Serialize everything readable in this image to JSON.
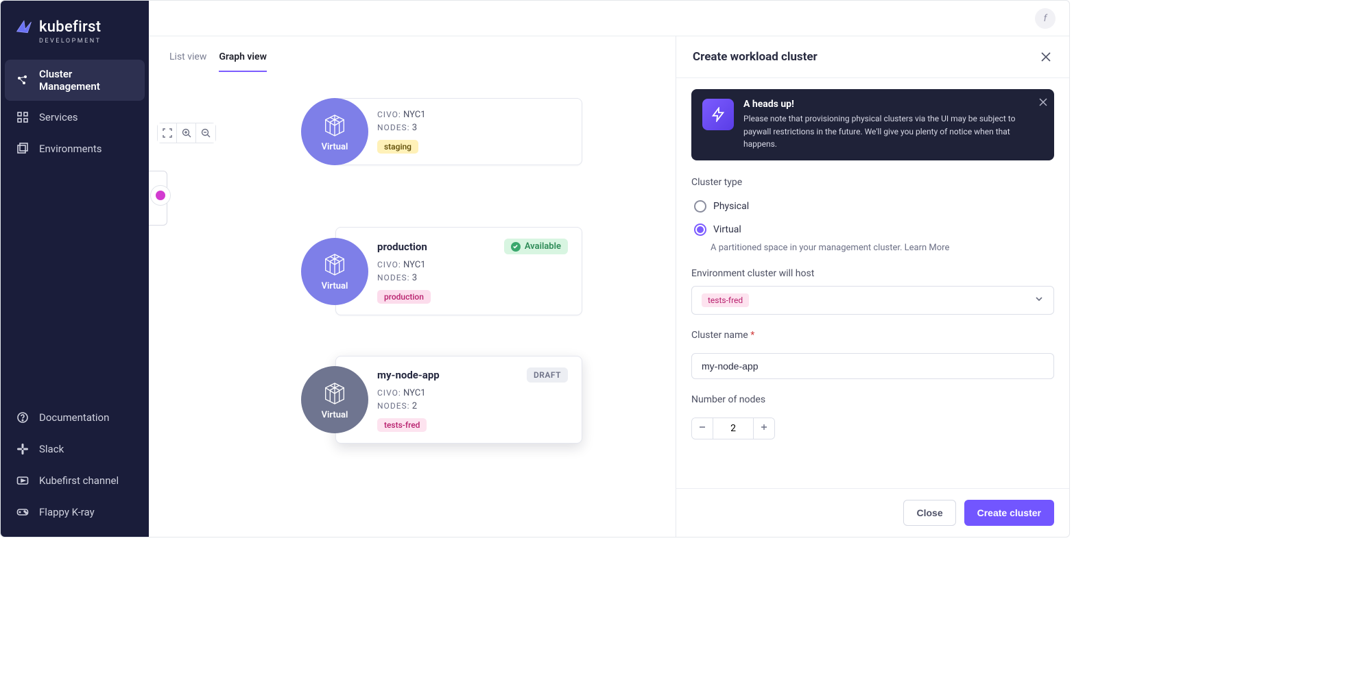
{
  "brand": {
    "name": "kubefirst",
    "sub": "DEVELOPMENT"
  },
  "avatar": {
    "initials": "f"
  },
  "nav": {
    "top": [
      {
        "label": "Cluster Management",
        "icon": "cluster-icon",
        "active": true
      },
      {
        "label": "Services",
        "icon": "grid-icon",
        "active": false
      },
      {
        "label": "Environments",
        "icon": "stack-icon",
        "active": false
      }
    ],
    "bottom": [
      {
        "label": "Documentation",
        "icon": "help-circle-icon"
      },
      {
        "label": "Slack",
        "icon": "slack-icon"
      },
      {
        "label": "Kubefirst channel",
        "icon": "youtube-icon"
      },
      {
        "label": "Flappy K-ray",
        "icon": "gamepad-icon"
      }
    ]
  },
  "tabs": {
    "list": "List view",
    "graph": "Graph view",
    "active": "graph"
  },
  "graph": {
    "tools": [
      "fit-icon",
      "zoom-in-icon",
      "zoom-out-icon"
    ],
    "hub": {
      "color": "#d23bd0"
    },
    "nodes": [
      {
        "kind": "virtual",
        "kind_label": "Virtual",
        "title_hidden": true,
        "cloud_label": "CIVO:",
        "cloud_value": "NYC1",
        "nodes_label": "NODES:",
        "nodes_value": "3",
        "env_tag": "staging",
        "env_class": "staging"
      },
      {
        "kind": "virtual",
        "kind_label": "Virtual",
        "title": "production",
        "status": {
          "label": "Available",
          "kind": "available"
        },
        "cloud_label": "CIVO:",
        "cloud_value": "NYC1",
        "nodes_label": "NODES:",
        "nodes_value": "3",
        "env_tag": "production",
        "env_class": "production"
      },
      {
        "kind": "draft",
        "kind_label": "Virtual",
        "title": "my-node-app",
        "status": {
          "label": "DRAFT",
          "kind": "draft"
        },
        "cloud_label": "CIVO:",
        "cloud_value": "NYC1",
        "nodes_label": "NODES:",
        "nodes_value": "2",
        "env_tag": "tests-fred",
        "env_class": "tests"
      }
    ]
  },
  "panel": {
    "title": "Create workload cluster",
    "alert": {
      "title": "A heads up!",
      "text": "Please note that provisioning physical clusters via the UI may be subject to paywall restrictions in the future. We'll give you plenty of notice when that happens."
    },
    "cluster_type": {
      "label": "Cluster type",
      "options": {
        "physical": "Physical",
        "virtual": "Virtual"
      },
      "selected": "virtual",
      "virtual_hint": "A partitioned space in your management cluster. ",
      "learn_more": "Learn More"
    },
    "env_field": {
      "label": "Environment cluster will host",
      "value": "tests-fred"
    },
    "name_field": {
      "label": "Cluster name",
      "value": "my-node-app"
    },
    "node_count": {
      "label": "Number of nodes",
      "value": "2"
    },
    "footer": {
      "close": "Close",
      "create": "Create cluster"
    }
  }
}
